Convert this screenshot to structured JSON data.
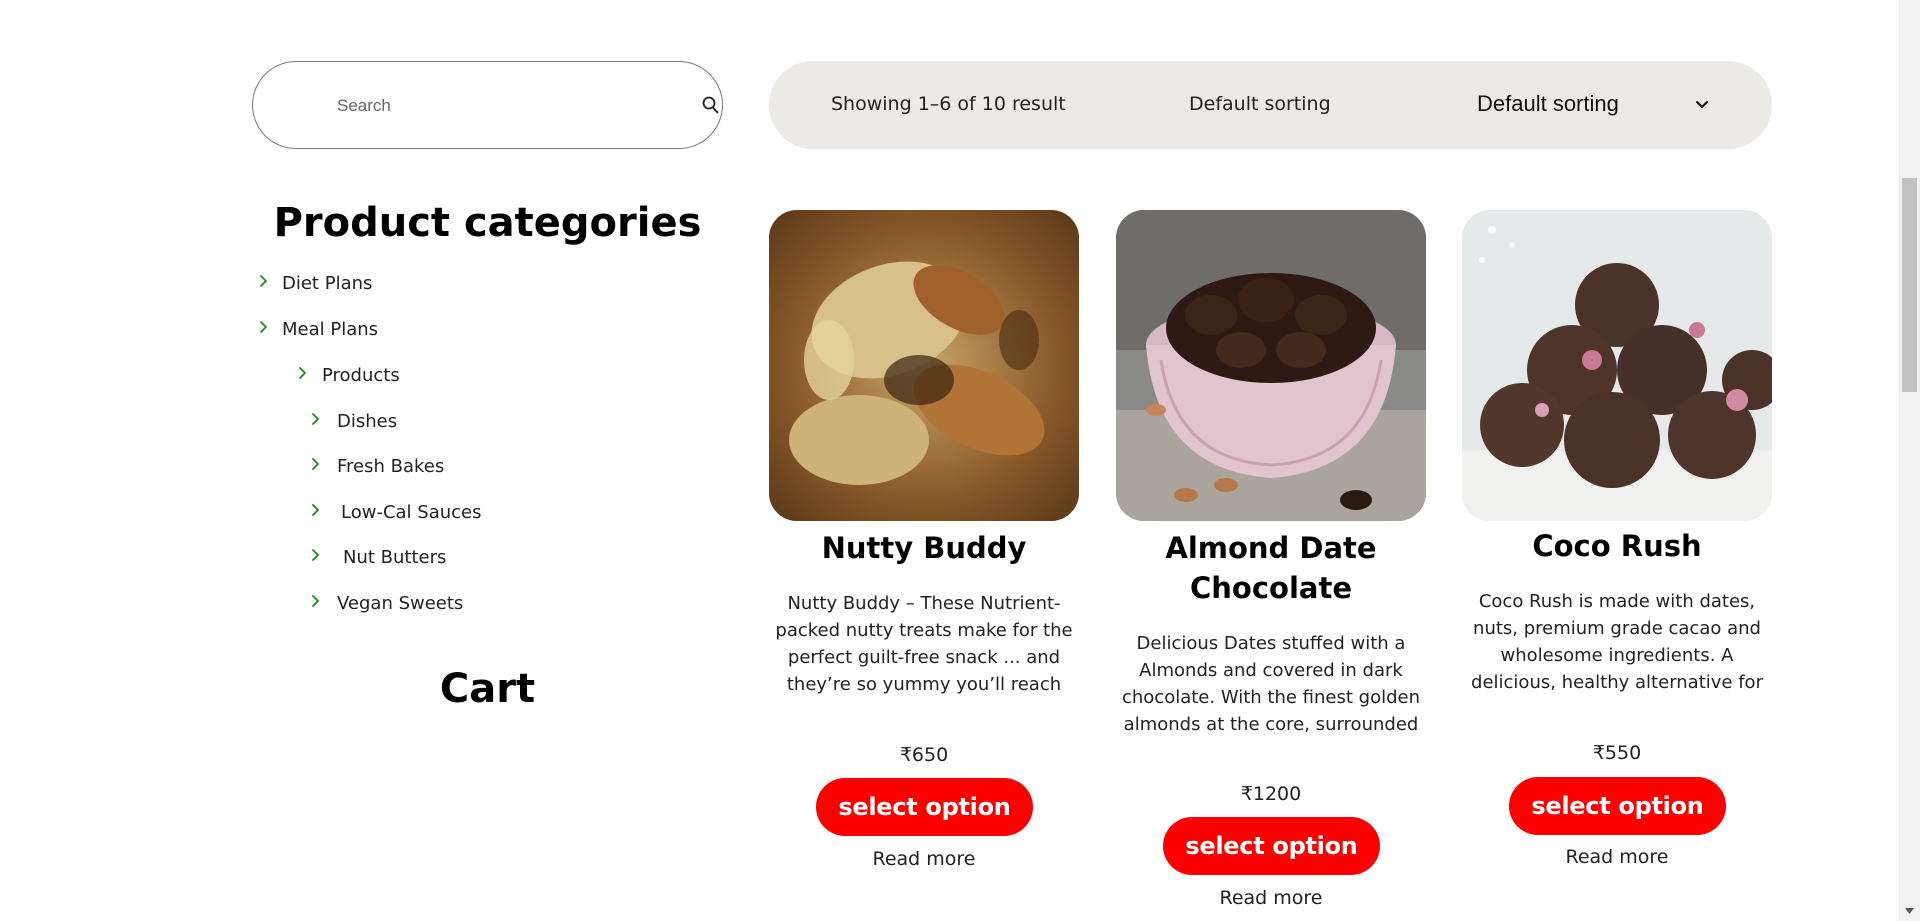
{
  "search": {
    "placeholder": "Search",
    "value": ""
  },
  "toolbar": {
    "result_count": "Showing 1–6 of 10 result",
    "sort_label": "Default sorting",
    "sort_selected": "Default sorting"
  },
  "sidebar": {
    "categories_title": "Product categories",
    "categories": [
      {
        "label": "Diet Plans"
      },
      {
        "label": "Meal Plans"
      },
      {
        "label": "Products"
      },
      {
        "label": "Dishes"
      },
      {
        "label": "Fresh Bakes"
      },
      {
        "label": "Low-Cal Sauces"
      },
      {
        "label": "Nut Butters"
      },
      {
        "label": "Vegan Sweets"
      }
    ],
    "cart_title": "Cart"
  },
  "products": [
    {
      "name": "Nutty Buddy",
      "description": "Nutty Buddy – These Nutrient-packed nutty treats make for the perfect guilt-free snack ... and they’re so yummy you’ll reach for them every chance you get.",
      "price": "₹650",
      "button_label": "select option",
      "read_more": "Read more"
    },
    {
      "name": "Almond Date Chocolate",
      "description": "Delicious Dates stuffed with a Almonds and covered in dark chocolate. With the finest golden almonds at the core, surrounded by irresistible luscious dates and",
      "price": "₹1200",
      "button_label": "select option",
      "read_more": "Read more"
    },
    {
      "name": "Coco Rush",
      "description": "Coco Rush is made with dates, nuts, premium grade cacao and wholesome ingredients. A delicious, healthy alternative for your sweet tooth cravings.",
      "price": "₹550",
      "button_label": "select option",
      "read_more": "Read more"
    }
  ],
  "colors": {
    "accent_button": "#fc0000",
    "toolbar_bg": "#ebeae6",
    "category_arrow": "#1a8a1a"
  },
  "icons": {
    "search": "search-icon",
    "sort_toggle": "chevron-down-icon",
    "category_arrow": "chevron-right-icon"
  }
}
